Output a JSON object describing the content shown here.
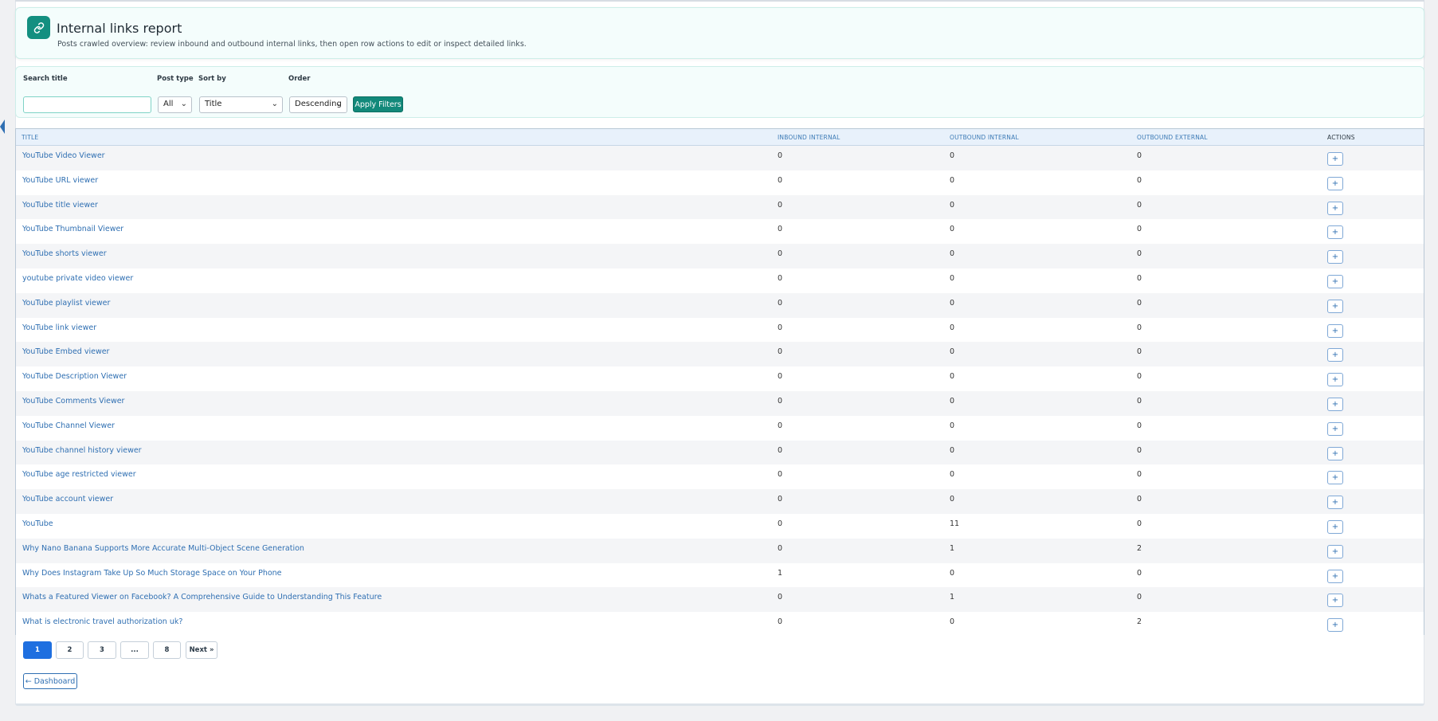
{
  "header": {
    "title": "Internal links report",
    "description": "Posts crawled overview: review inbound and outbound internal links, then open row actions to edit or inspect detailed links.",
    "icon": "link-icon"
  },
  "filters": {
    "search_label": "Search title",
    "search_value": "",
    "search_placeholder": "",
    "post_type_label": "Post type",
    "post_type_value": "All",
    "sort_by_label": "Sort by",
    "sort_by_value": "Title",
    "order_label": "Order",
    "order_value": "Descending",
    "apply_label": "Apply Filters"
  },
  "table": {
    "columns": [
      "TITLE",
      "INBOUND INTERNAL",
      "OUTBOUND INTERNAL",
      "OUTBOUND EXTERNAL",
      "ACTIONS"
    ],
    "action_label": "+",
    "rows": [
      {
        "title": "YouTube Video Viewer",
        "inbound": "0",
        "outbound_internal": "0",
        "outbound_external": "0"
      },
      {
        "title": "YouTube URL viewer",
        "inbound": "0",
        "outbound_internal": "0",
        "outbound_external": "0"
      },
      {
        "title": "YouTube title viewer",
        "inbound": "0",
        "outbound_internal": "0",
        "outbound_external": "0"
      },
      {
        "title": "YouTube Thumbnail Viewer",
        "inbound": "0",
        "outbound_internal": "0",
        "outbound_external": "0"
      },
      {
        "title": "YouTube shorts viewer",
        "inbound": "0",
        "outbound_internal": "0",
        "outbound_external": "0"
      },
      {
        "title": "youtube private video viewer",
        "inbound": "0",
        "outbound_internal": "0",
        "outbound_external": "0"
      },
      {
        "title": "YouTube playlist viewer",
        "inbound": "0",
        "outbound_internal": "0",
        "outbound_external": "0"
      },
      {
        "title": "YouTube link viewer",
        "inbound": "0",
        "outbound_internal": "0",
        "outbound_external": "0"
      },
      {
        "title": "YouTube Embed viewer",
        "inbound": "0",
        "outbound_internal": "0",
        "outbound_external": "0"
      },
      {
        "title": "YouTube Description Viewer",
        "inbound": "0",
        "outbound_internal": "0",
        "outbound_external": "0"
      },
      {
        "title": "YouTube Comments Viewer",
        "inbound": "0",
        "outbound_internal": "0",
        "outbound_external": "0"
      },
      {
        "title": "YouTube Channel Viewer",
        "inbound": "0",
        "outbound_internal": "0",
        "outbound_external": "0"
      },
      {
        "title": "YouTube channel history viewer",
        "inbound": "0",
        "outbound_internal": "0",
        "outbound_external": "0"
      },
      {
        "title": "YouTube age restricted viewer",
        "inbound": "0",
        "outbound_internal": "0",
        "outbound_external": "0"
      },
      {
        "title": "YouTube account viewer",
        "inbound": "0",
        "outbound_internal": "0",
        "outbound_external": "0"
      },
      {
        "title": "YouTube",
        "inbound": "0",
        "outbound_internal": "11",
        "outbound_external": "0"
      },
      {
        "title": "Why Nano Banana Supports More Accurate Multi-Object Scene Generation",
        "inbound": "0",
        "outbound_internal": "1",
        "outbound_external": "2"
      },
      {
        "title": "Why Does Instagram Take Up So Much Storage Space on Your Phone",
        "inbound": "1",
        "outbound_internal": "0",
        "outbound_external": "0"
      },
      {
        "title": "Whats a Featured Viewer on Facebook? A Comprehensive Guide to Understanding This Feature",
        "inbound": "0",
        "outbound_internal": "1",
        "outbound_external": "0"
      },
      {
        "title": "What is electronic travel authorization uk?",
        "inbound": "0",
        "outbound_internal": "0",
        "outbound_external": "2"
      }
    ]
  },
  "pagination": {
    "pages": [
      "1",
      "2",
      "3",
      "...",
      "8"
    ],
    "current": "1",
    "next_label": "Next »"
  },
  "footer": {
    "dashboard_label": "← Dashboard"
  },
  "colors": {
    "accent": "#12897a",
    "link": "#2f6fb2",
    "active_page": "#1e6fe0"
  }
}
